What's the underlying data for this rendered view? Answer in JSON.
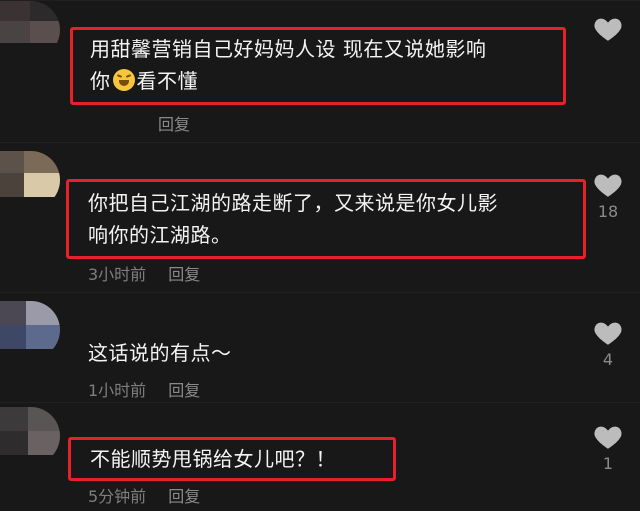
{
  "comments": [
    {
      "text_line1": "用甜馨营销自己好妈妈人设 现在又说她影响",
      "text_line2_before": "你",
      "emoji": "laughing-crying-emoji",
      "text_line2_after": "看不懂",
      "time": "",
      "reply": "回复",
      "likes": ""
    },
    {
      "text_line1": "你把自己江湖的路走断了，又来说是你女儿影",
      "text_line2": "响你的江湖路。",
      "time": "3小时前",
      "reply": "回复",
      "likes": "18"
    },
    {
      "text": "这话说的有点～",
      "time": "1小时前",
      "reply": "回复",
      "likes": "4"
    },
    {
      "text": "不能顺势甩锅给女儿吧？！",
      "time": "5分钟前",
      "reply": "回复",
      "likes": "1"
    }
  ],
  "colors": {
    "highlight": "#e8202a",
    "background": "#161616",
    "meta_text": "#7e7e7e"
  },
  "icons": {
    "like": "heart-icon"
  }
}
